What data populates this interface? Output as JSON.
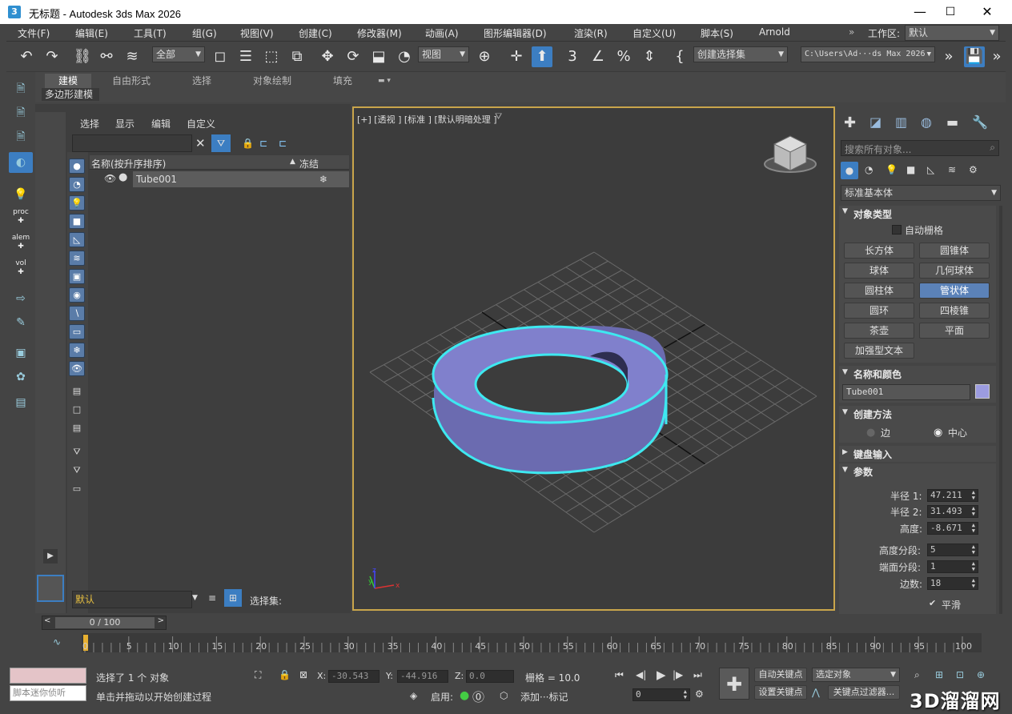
{
  "window": {
    "title": "无标题 - Autodesk 3ds Max 2026",
    "app_badge": "3"
  },
  "menu": {
    "items": [
      "文件(F)",
      "编辑(E)",
      "工具(T)",
      "组(G)",
      "视图(V)",
      "创建(C)",
      "修改器(M)",
      "动画(A)",
      "图形编辑器(D)",
      "渲染(R)",
      "自定义(U)",
      "脚本(S)",
      "Arnold"
    ],
    "workspace_label": "工作区:",
    "workspace_value": "默认"
  },
  "toolbar": {
    "selection_filter": "全部",
    "ref_coord": "视图",
    "named_selection": "创建选择集",
    "project_path": "C:\\Users\\Ad···ds Max 2026"
  },
  "ribbon": {
    "tabs": [
      "建模",
      "自由形式",
      "选择",
      "对象绘制",
      "填充"
    ],
    "subtab": "多边形建模"
  },
  "explorer": {
    "menu": [
      "选择",
      "显示",
      "编辑",
      "自定义"
    ],
    "col_name": "名称(按升序排序)",
    "col_sort_arrow": "▲",
    "col_freeze": "冻结",
    "rows": [
      {
        "name": "Tube001"
      }
    ],
    "layer_value": "默认",
    "selset_label": "选择集:"
  },
  "viewport": {
    "label": "[+] [透视 ] [标准 ] [默认明暗处理 ]",
    "object_color": "#7c7cc4",
    "highlight_color": "#3ee8f0"
  },
  "command_panel": {
    "search_placeholder": "搜索所有对象...",
    "category": "标准基本体",
    "object_type": {
      "title": "对象类型",
      "autogrid": "自动栅格",
      "buttons": [
        "长方体",
        "圆锥体",
        "球体",
        "几何球体",
        "圆柱体",
        "管状体",
        "圆环",
        "四棱锥",
        "茶壶",
        "平面",
        "加强型文本"
      ],
      "active": "管状体"
    },
    "name_color": {
      "title": "名称和颜色",
      "name": "Tube001",
      "color": "#9c9ce0"
    },
    "creation_method": {
      "title": "创建方法",
      "opt1": "边",
      "opt2": "中心",
      "selected": "中心"
    },
    "keyboard_entry": {
      "title": "键盘输入"
    },
    "params": {
      "title": "参数",
      "radius1_label": "半径 1:",
      "radius1": "47.211",
      "radius2_label": "半径 2:",
      "radius2": "31.493",
      "height_label": "高度:",
      "height": "-8.671",
      "hseg_label": "高度分段:",
      "hseg": "5",
      "capseg_label": "端面分段:",
      "capseg": "1",
      "sides_label": "边数:",
      "sides": "18",
      "smooth_label": "平滑"
    }
  },
  "timeline": {
    "frame_display": "0 / 100",
    "ticks": [
      "0",
      "5",
      "10",
      "15",
      "20",
      "25",
      "30",
      "35",
      "40",
      "45",
      "50",
      "55",
      "60",
      "65",
      "70",
      "75",
      "80",
      "85",
      "90",
      "95",
      "100"
    ]
  },
  "status": {
    "script_listener": "脚本迷你侦听",
    "selected": "选择了 1 个 对象",
    "prompt": "单击并拖动以开始创建过程",
    "x_label": "X:",
    "x": "-30.543",
    "y_label": "Y:",
    "y": "-44.916",
    "z_label": "Z:",
    "z": "0.0",
    "grid": "栅格 = 10.0",
    "enable": "启用:",
    "add_tag": "添加···标记",
    "auto_key": "自动关键点",
    "set_key": "设置关键点",
    "key_mode": "选定对象",
    "key_filters": "关键点过滤器...",
    "current_frame": "0"
  },
  "watermark": "3D溜溜网"
}
